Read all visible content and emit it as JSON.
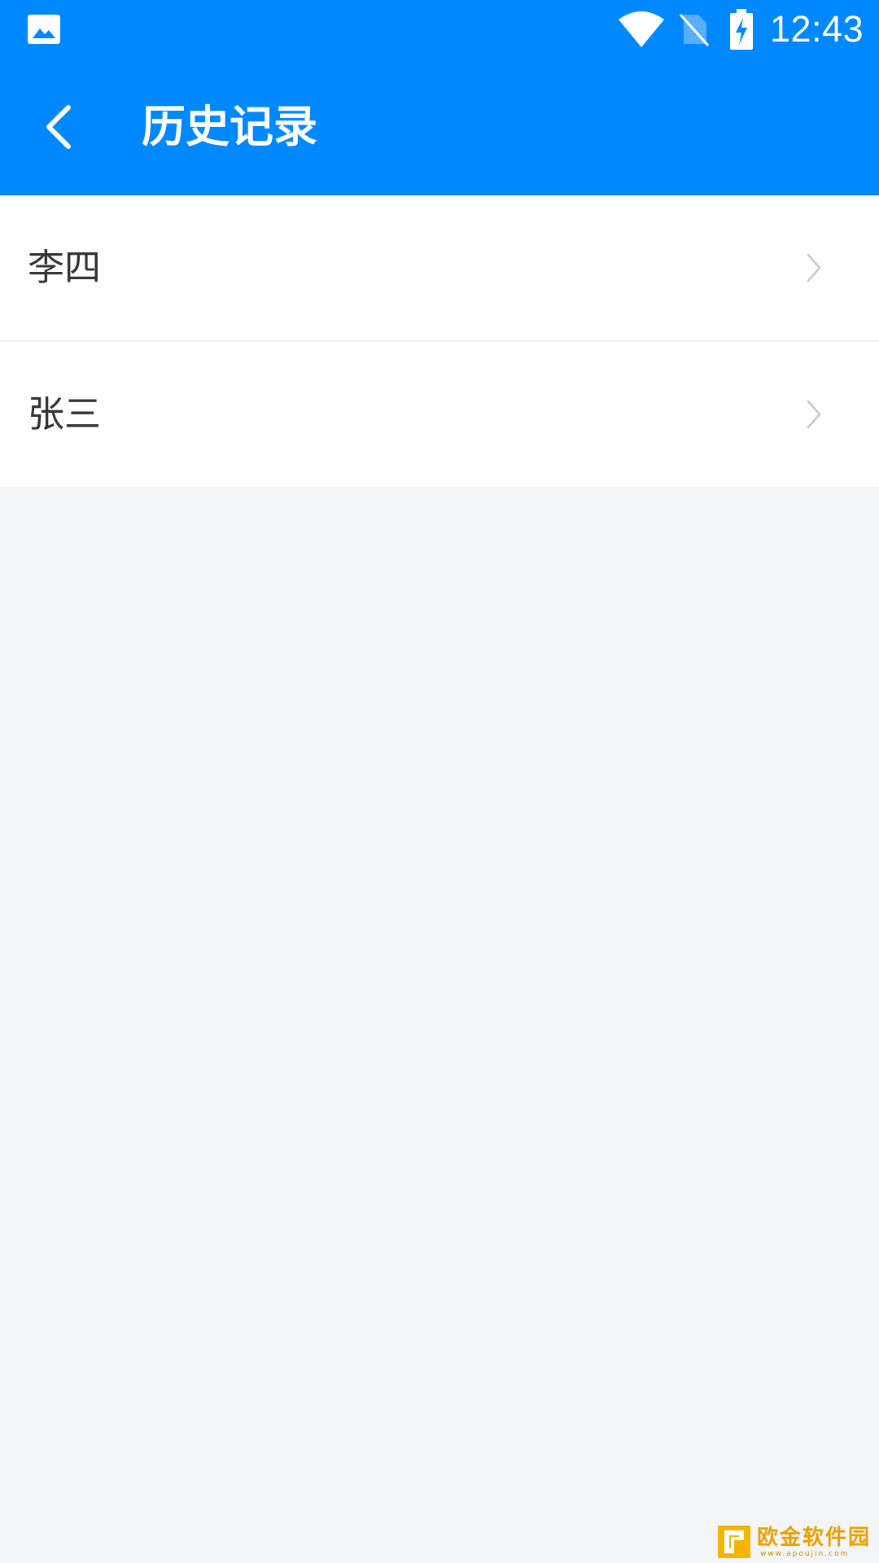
{
  "status_bar": {
    "time": "12:43",
    "icons": [
      "gallery-icon",
      "wifi-icon",
      "no-sim-icon",
      "battery-charging-icon"
    ]
  },
  "app_bar": {
    "back_icon": "chevron-left-icon",
    "title": "历史记录"
  },
  "history": {
    "items": [
      {
        "label": "李四",
        "icon": "chevron-right-icon"
      },
      {
        "label": "张三",
        "icon": "chevron-right-icon"
      }
    ]
  },
  "watermark": {
    "text": "欧金软件园",
    "url": "www.apoujin.com"
  },
  "colors": {
    "primary": "#0088fe",
    "background": "#f4f5f9",
    "list_background": "#ffffff",
    "text": "#333333",
    "chevron": "#c7c7cc",
    "watermark": "#e8a100"
  }
}
